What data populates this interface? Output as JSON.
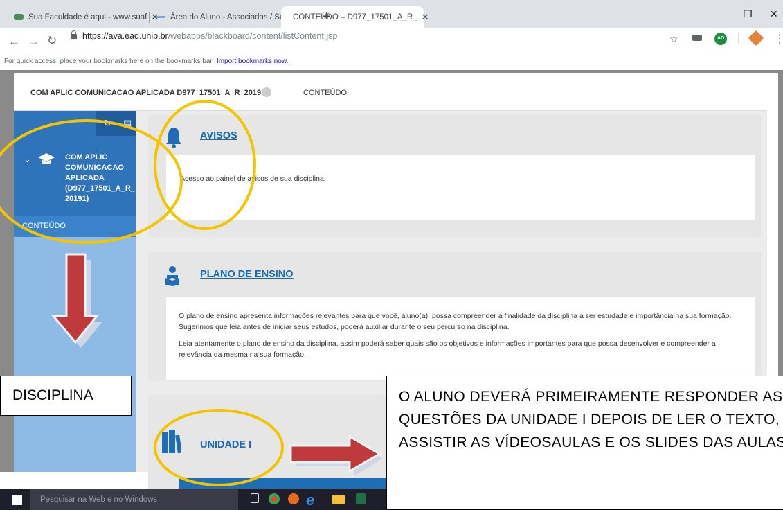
{
  "browser": {
    "tabs": [
      {
        "label": "Sua Faculdade é aqui - www.suaf"
      },
      {
        "label": "Área do Aluno - Associadas / Sua"
      },
      {
        "label": "CONTEÚDO – D977_17501_A_R_"
      }
    ],
    "url_host": "https://ava.ead.unip.br",
    "url_path": "/webapps/blackboard/content/listContent.jsp",
    "bookmarks_hint": "For quick access, place your bookmarks here on the bookmarks bar.",
    "bookmarks_link": "Import bookmarks now...",
    "avatar_initials": "AD",
    "accent": "#1669b8"
  },
  "course": {
    "breadcrumb": "COM APLIC COMUNICACAO APLICADA D977_17501_A_R_20191",
    "current_page": "CONTEÚDO",
    "sidebar_course_name": "COM APLIC COMUNICACAO APLICADA (D977_17501_A_R_ 20191)",
    "sidebar_selected": "CONTEÚDO"
  },
  "items": [
    {
      "title": "AVISOS",
      "body": [
        "Acesso ao painel de avisos de sua disciplina."
      ]
    },
    {
      "title": "PLANO DE ENSINO",
      "body": [
        "O plano de ensino apresenta informações relevantes para que você, aluno(a), possa compreender a finalidade da disciplina a ser estudada e importância na sua formação. Sugerimos que leia antes de iniciar seus estudos, poderá auxiliar durante o seu percurso na disciplina.",
        "Leia atentamente o plano de ensino da disciplina, assim poderá saber quais são os objetivos e informações importantes para que possa desenvolver e compreender a relevância da mesma na sua formação."
      ]
    },
    {
      "title": "UNIDADE I"
    }
  ],
  "annotations": {
    "disciplina": "DISCIPLINA",
    "message": "O ALUNO DEVERÁ PRIMEIRAMENTE RESPONDER AS QUESTÕES DA UNIDADE I DEPOIS DE LER O TEXTO, ASSISTIR AS VÍDEOSAULAS E OS SLIDES DAS AULAS",
    "highlight_color": "#f5c400",
    "arrow_color": "#c0393b"
  },
  "taskbar": {
    "search_placeholder": "Pesquisar na Web e no Windows"
  }
}
